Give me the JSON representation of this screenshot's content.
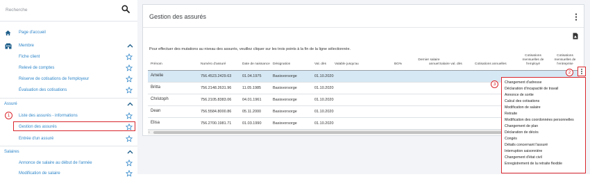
{
  "sidebar": {
    "search_placeholder": "Recherche",
    "home": "Page d'accueil",
    "member_section": "Membre",
    "member_items": [
      "Fiche client",
      "Relevé de comptes",
      "Réserve de cotisations de l'employeur",
      "Évaluation des cotisations"
    ],
    "insured_section": "Assuré",
    "insured_items": [
      "Liste des assurés - informations",
      "Gestion des assurés",
      "Entrée d'un assuré"
    ],
    "salaries_section": "Salaires",
    "salary_items": [
      "Annonce de salaire au début de l'année",
      "Modification de salaire"
    ]
  },
  "annotations": {
    "one": "1",
    "two": "2",
    "three": "3"
  },
  "main": {
    "title": "Gestion des assurés",
    "intro": "Pour effectuer des mutations au niveau des assurés, veuillez cliquer sur les trois points à la fin de la ligne sélectionnée.",
    "headers": {
      "prenom": "Prénom",
      "numero": "Numéro d'assuré",
      "naissance": "Date de naissance",
      "designation": "Désignation",
      "val_des": "Val. dès",
      "valable": "Valable jusqu'au",
      "bg": "BG%",
      "dernier_1": "Dernier salaire",
      "dernier_2": "annuel",
      "salaire_val": "Salaire val. dès",
      "cot_ann": "Cotisations annuelles",
      "cot_emp_1": "Cotisations",
      "cot_emp_2": "mensuelles de",
      "cot_emp_3": "l'employé",
      "cot_ent_1": "Cotisations",
      "cot_ent_2": "mensuelles de",
      "cot_ent_3": "l'entreprise"
    },
    "rows": [
      {
        "prenom": "Amelie",
        "numero": "756.4523.2429.63",
        "naissance": "01.04.1975",
        "designation": "Basisvorsorge",
        "val_des": "01.10.2020"
      },
      {
        "prenom": "Britta",
        "numero": "756.2148.2631.96",
        "naissance": "11.05.1985",
        "designation": "Basisvorsorge",
        "val_des": "01.10.2020"
      },
      {
        "prenom": "Christoph",
        "numero": "756.2105.8383.06",
        "naissance": "04.01.1961",
        "designation": "Basisvorsorge",
        "val_des": "01.10.2020"
      },
      {
        "prenom": "Dean",
        "numero": "756.5584.8000.86",
        "naissance": "05.11.2000",
        "designation": "Basisvorsorge",
        "val_des": "01.10.2020"
      },
      {
        "prenom": "Elisa",
        "numero": "756.2700.1981.71",
        "naissance": "01.03.1990",
        "designation": "Basisvorsorge",
        "val_des": "01.10.2020"
      }
    ],
    "scroll_left": "‹"
  },
  "menu": {
    "items": [
      "Changement d'adresse",
      "Déclaration d'incapacité de travail",
      "Annonce de sortie",
      "Calcul des cotisations",
      "Modification de salaire",
      "Retraite",
      "Modification des coordonnées personnelles",
      "Changement de plan",
      "Déclaration de décès",
      "Congés",
      "Détails concernant l'assuré",
      "Interruption saisonnière",
      "Changement d'état civil",
      "Enregistrement de la retraite flexible"
    ]
  },
  "colors": {
    "link": "#2f86c9",
    "nav_blue": "#1f5f8b",
    "highlight": "#d9252b",
    "selected_row": "#d6e8f4"
  },
  "icons": [
    "search-icon",
    "home-icon",
    "member-icon",
    "star-icon",
    "chevron-up-icon",
    "kebab-icon",
    "pdf-icon"
  ]
}
